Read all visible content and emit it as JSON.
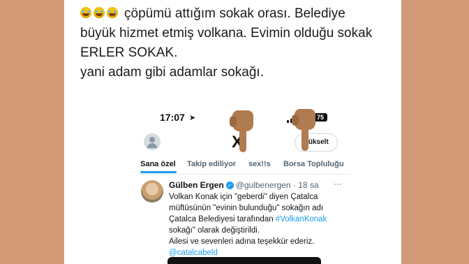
{
  "caption": {
    "lines": [
      "çöpümü attığım sokak orası. Belediye",
      "büyük hizmet etmiş volkana. Evimin olduğu sokak",
      "ERLER SOKAK.",
      "yani adam gibi adamlar sokağı."
    ],
    "emoji_icons": [
      "laughing-tears-icon",
      "laughing-tears-icon",
      "laughing-tears-icon"
    ]
  },
  "phone": {
    "time": "17:07",
    "battery": "75",
    "logo": "X",
    "upgrade_label": "Yükselt"
  },
  "tabs": [
    "Sana özel",
    "Takip ediliyor",
    "sex!!s",
    "Borsa Topluluğu"
  ],
  "tweet": {
    "name": "Gülben Ergen",
    "handle": "@gulbenergen",
    "time": "· 18 sa",
    "more": "···",
    "lines": [
      "Volkan Konak için \"geberdi\" diyen Çatalca",
      "müftüsünün \"evinin bulunduğu\" sokağın adı",
      "Çatalca Belediyesi tarafından",
      "sokağı\" olarak değiştirildi.",
      "Ailesi ve sevenleri adına teşekkür ederiz."
    ],
    "hashtag": "#VolkanKonak",
    "mention": "@catalcabeld"
  },
  "colors": {
    "background": "#d39a78",
    "accent": "#1d9bf0"
  }
}
